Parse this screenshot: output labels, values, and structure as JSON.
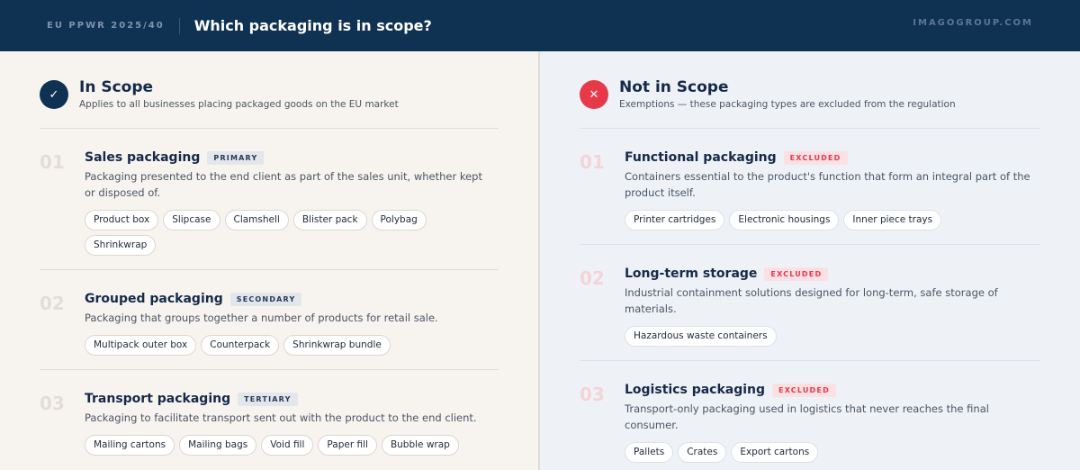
{
  "header": {
    "eyebrow": "EU PPWR 2025/40",
    "title": "Which packaging is in scope?",
    "brand": "IMAGOGROUP.COM"
  },
  "in_scope": {
    "icon": "check-icon",
    "title": "In Scope",
    "subtitle": "Applies to all businesses placing packaged goods on the EU market",
    "items": [
      {
        "num": "01",
        "title": "Sales packaging",
        "tag": "PRIMARY",
        "desc": "Packaging presented to the end client as part of the sales unit, whether kept or disposed of.",
        "chips": [
          "Product box",
          "Slipcase",
          "Clamshell",
          "Blister pack",
          "Polybag",
          "Shrinkwrap"
        ]
      },
      {
        "num": "02",
        "title": "Grouped packaging",
        "tag": "SECONDARY",
        "desc": "Packaging that groups together a number of products for retail sale.",
        "chips": [
          "Multipack outer box",
          "Counterpack",
          "Shrinkwrap bundle"
        ]
      },
      {
        "num": "03",
        "title": "Transport packaging",
        "tag": "TERTIARY",
        "desc": "Packaging to facilitate transport sent out with the product to the end client.",
        "chips": [
          "Mailing cartons",
          "Mailing bags",
          "Void fill",
          "Paper fill",
          "Bubble wrap"
        ]
      }
    ]
  },
  "not_in_scope": {
    "icon": "x-icon",
    "title": "Not in Scope",
    "subtitle": "Exemptions — these packaging types are excluded from the regulation",
    "items": [
      {
        "num": "01",
        "title": "Functional packaging",
        "tag": "EXCLUDED",
        "desc": "Containers essential to the product's function that form an integral part of the product itself.",
        "chips": [
          "Printer cartridges",
          "Electronic housings",
          "Inner piece trays"
        ]
      },
      {
        "num": "02",
        "title": "Long-term storage",
        "tag": "EXCLUDED",
        "desc": "Industrial containment solutions designed for long-term, safe storage of materials.",
        "chips": [
          "Hazardous waste containers"
        ]
      },
      {
        "num": "03",
        "title": "Logistics packaging",
        "tag": "EXCLUDED",
        "desc": "Transport-only packaging used in logistics that never reaches the final consumer.",
        "chips": [
          "Pallets",
          "Crates",
          "Export cartons"
        ]
      }
    ]
  },
  "colors": {
    "navy": "#0f3253",
    "red": "#e8394b"
  }
}
